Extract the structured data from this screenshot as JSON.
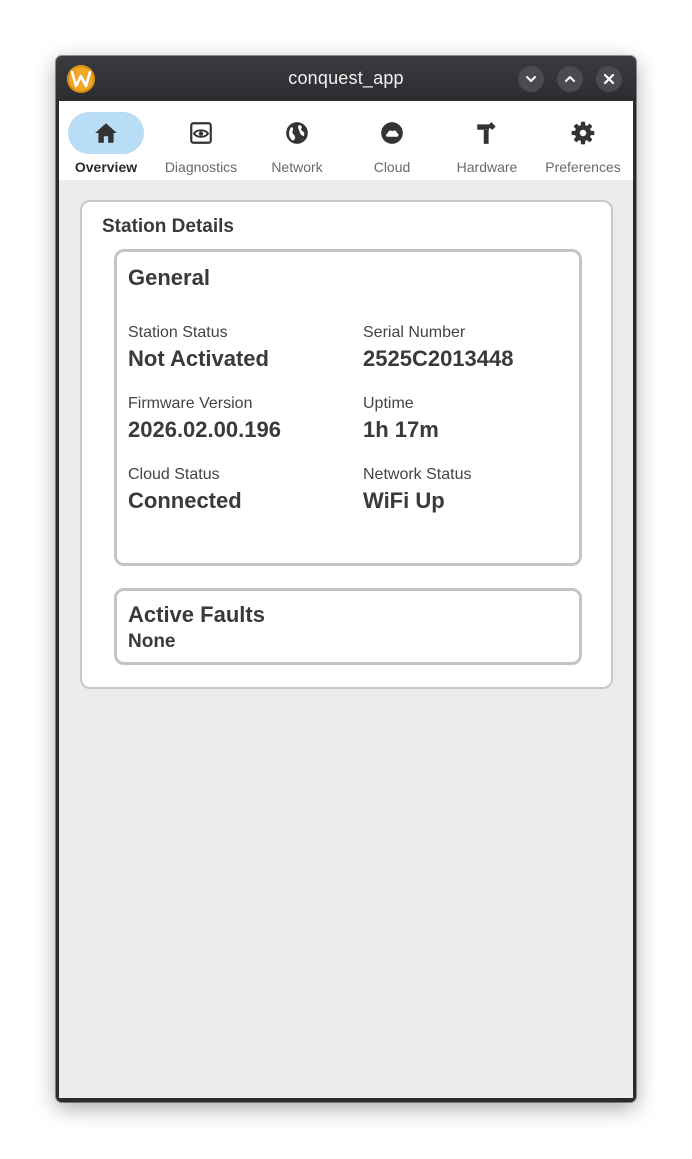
{
  "window": {
    "title": "conquest_app",
    "logo_letter": "W",
    "controls": [
      "minimize",
      "maximize",
      "close"
    ]
  },
  "nav": {
    "active": "Overview",
    "items": [
      {
        "label": "Overview",
        "icon": "home-icon"
      },
      {
        "label": "Diagnostics",
        "icon": "eye-icon"
      },
      {
        "label": "Network",
        "icon": "globe-icon"
      },
      {
        "label": "Cloud",
        "icon": "cloud-icon"
      },
      {
        "label": "Hardware",
        "icon": "hammer-icon"
      },
      {
        "label": "Preferences",
        "icon": "gear-icon"
      }
    ]
  },
  "station": {
    "title": "Station Details",
    "general": {
      "title": "General",
      "fields": [
        {
          "label": "Station Status",
          "value": "Not Activated"
        },
        {
          "label": "Serial Number",
          "value": "2525C2013448"
        },
        {
          "label": "Firmware Version",
          "value": "2026.02.00.196"
        },
        {
          "label": "Uptime",
          "value": "1h 17m"
        },
        {
          "label": "Cloud Status",
          "value": "Connected"
        },
        {
          "label": "Network Status",
          "value": "WiFi Up"
        }
      ]
    },
    "faults": {
      "title": "Active Faults",
      "value": "None"
    }
  },
  "colors": {
    "accent": "#b9dcf7",
    "logo": "#f0a728",
    "titlebar": "#2c2d30",
    "background": "#ececec"
  }
}
